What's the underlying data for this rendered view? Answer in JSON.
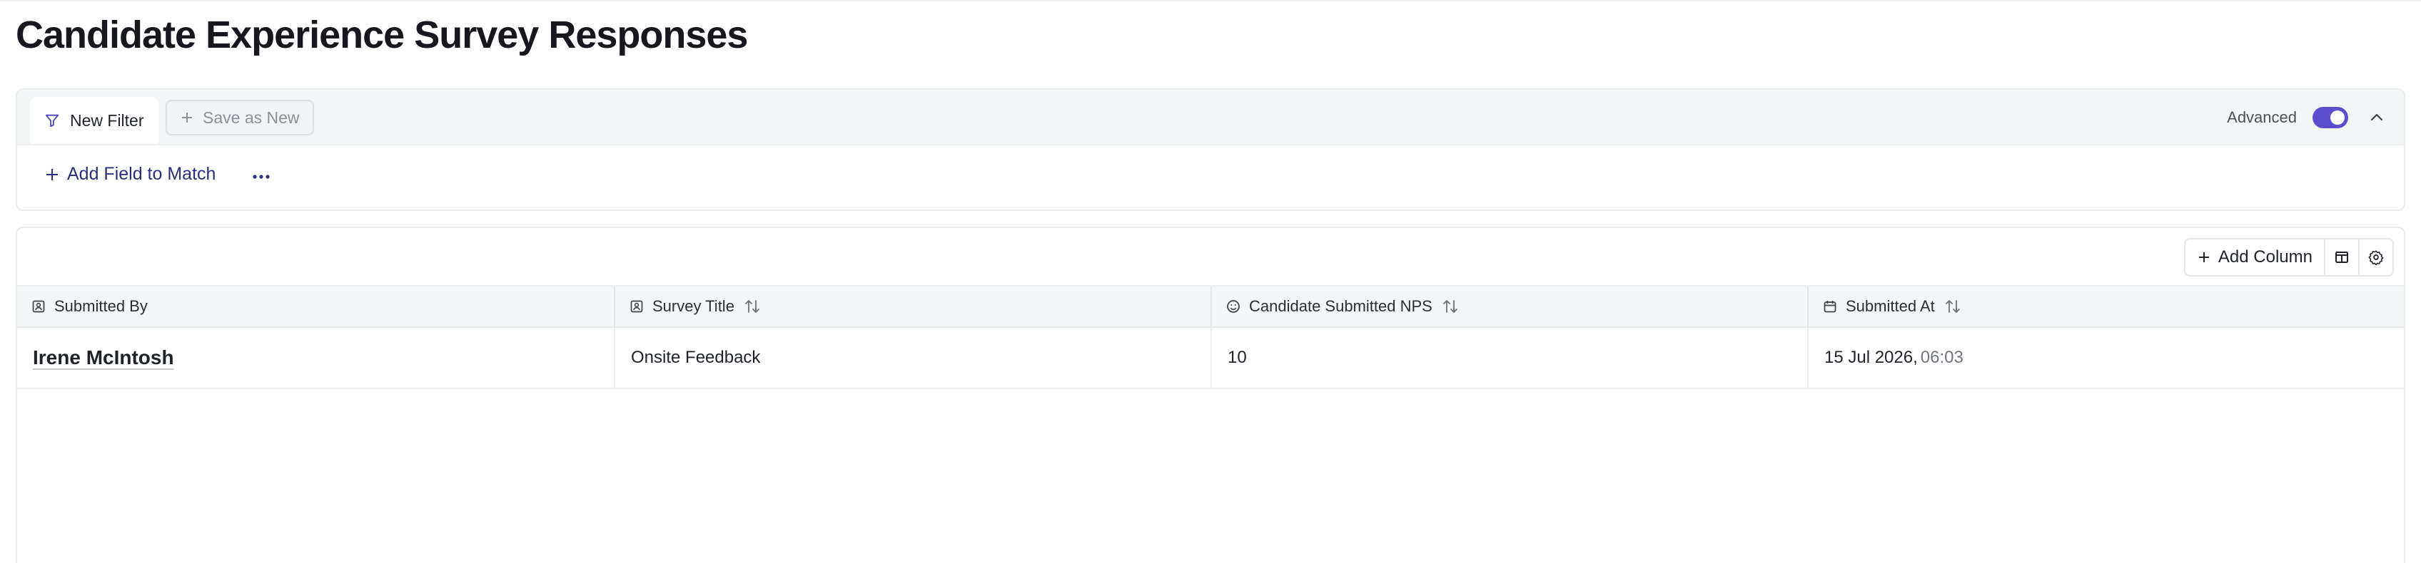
{
  "page": {
    "title": "Candidate Experience Survey Responses"
  },
  "filter": {
    "tab_label": "New Filter",
    "save_as_new_label": "Save as New",
    "advanced_label": "Advanced",
    "advanced_enabled": true,
    "add_field_label": "Add Field to Match"
  },
  "toolbar": {
    "add_column_label": "Add Column"
  },
  "table": {
    "columns": [
      {
        "label": "Submitted By",
        "icon": "person-card-icon",
        "sortable": false
      },
      {
        "label": "Survey Title",
        "icon": "person-card-icon",
        "sortable": true
      },
      {
        "label": "Candidate Submitted NPS",
        "icon": "smiley-icon",
        "sortable": true
      },
      {
        "label": "Submitted At",
        "icon": "calendar-icon",
        "sortable": true
      }
    ],
    "rows": [
      {
        "submitted_by": "Irene McIntosh",
        "survey_title": "Onsite Feedback",
        "nps": "10",
        "submitted_date": "15 Jul 2026,",
        "submitted_time": "06:03"
      }
    ]
  },
  "colors": {
    "accent": "#5b4fd0",
    "link": "#2c2f7a",
    "header_bg": "#f3f6f6"
  }
}
